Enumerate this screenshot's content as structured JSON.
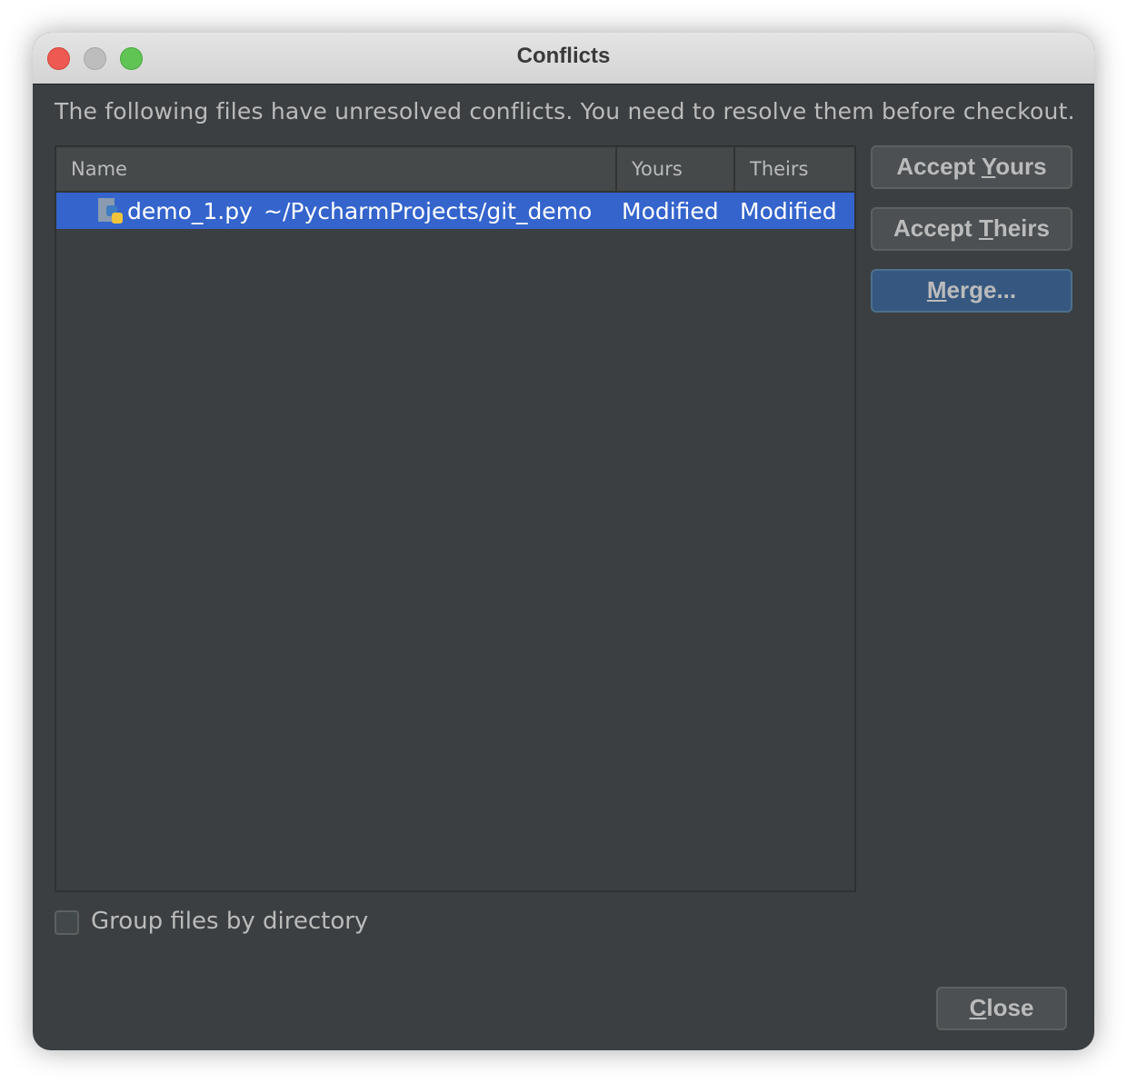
{
  "window": {
    "title": "Conflicts"
  },
  "message": "The following files have unresolved conflicts. You need to resolve them before checkout.",
  "table": {
    "columns": [
      "Name",
      "Yours",
      "Theirs"
    ],
    "rows": [
      {
        "icon": "python-file-icon",
        "name": "demo_1.py",
        "path": "~/PycharmProjects/git_demo",
        "yours": "Modified",
        "theirs": "Modified",
        "selected": true
      }
    ]
  },
  "buttons": {
    "accept_yours": {
      "pre": "Accept ",
      "mn": "Y",
      "post": "ours"
    },
    "accept_theirs": {
      "pre": "Accept ",
      "mn": "T",
      "post": "heirs"
    },
    "merge": {
      "pre": "",
      "mn": "M",
      "post": "erge..."
    },
    "close": {
      "pre": "",
      "mn": "C",
      "post": "lose"
    }
  },
  "group_by_directory": {
    "label": "Group files by directory",
    "checked": false
  },
  "colors": {
    "selection": "#3464cc",
    "default_button": "#365880",
    "background": "#3c3f41"
  }
}
